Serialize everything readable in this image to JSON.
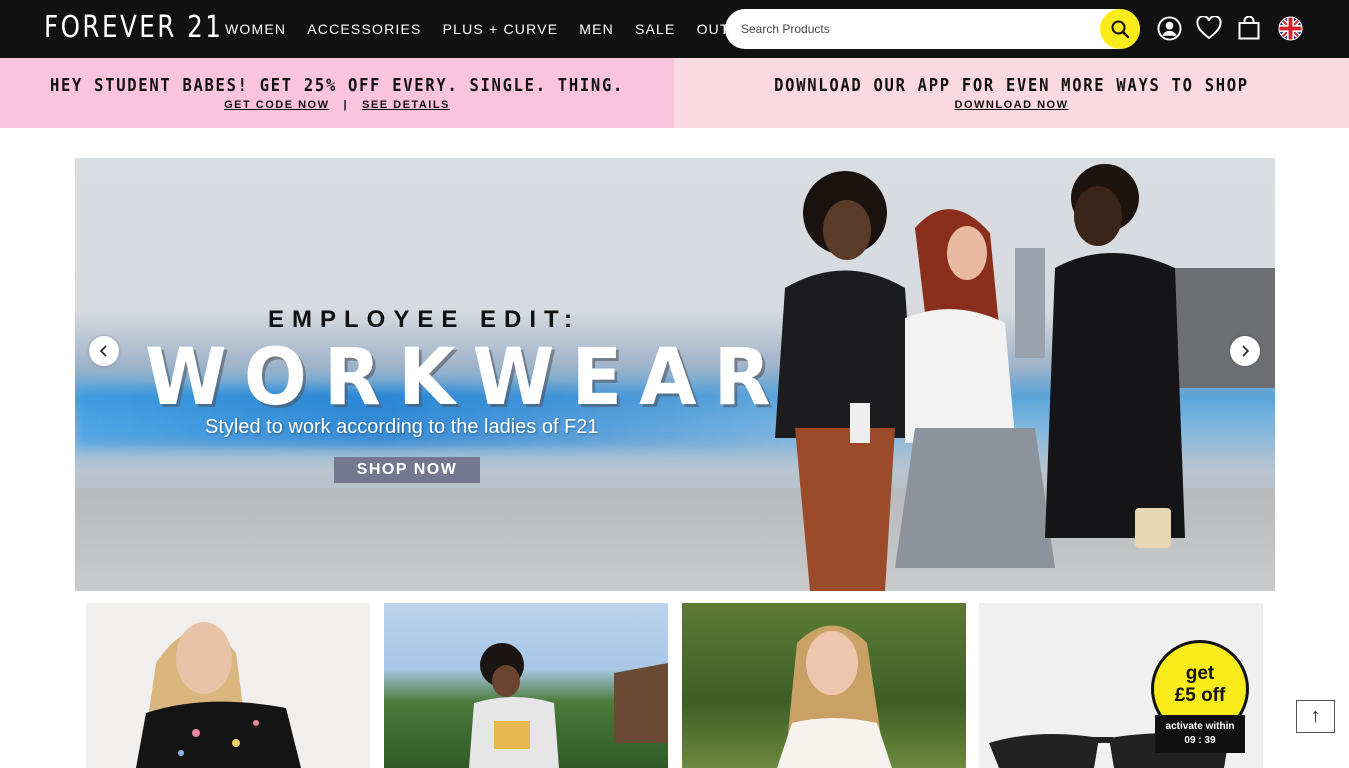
{
  "header": {
    "logo": "FOREVER 21",
    "nav": [
      "WOMEN",
      "ACCESSORIES",
      "PLUS + CURVE",
      "MEN",
      "SALE",
      "OUTLET"
    ],
    "search_placeholder": "Search Products",
    "icons": [
      "search-icon",
      "account-icon",
      "wishlist-heart-icon",
      "shopping-bag-icon",
      "uk-flag-icon"
    ]
  },
  "promos": [
    {
      "title": "HEY STUDENT BABES! GET 25% OFF EVERY. SINGLE. THING.",
      "links": [
        "GET CODE NOW",
        "SEE DETAILS"
      ],
      "separator": "|"
    },
    {
      "title": "DOWNLOAD OUR APP FOR EVEN MORE WAYS TO SHOP",
      "links": [
        "DOWNLOAD NOW"
      ]
    }
  ],
  "hero": {
    "eyebrow": "EMPLOYEE EDIT:",
    "headline": "WORKWEAR",
    "subhead": "Styled to work according to the ladies of F21",
    "cta": "SHOP NOW",
    "prev_icon": "chevron-left-icon",
    "next_icon": "chevron-right-icon",
    "colors": {
      "cta_bg": "#727890"
    }
  },
  "coupon": {
    "title_line1": "get",
    "title_line2": "£5 off",
    "timer_label": "activate within",
    "timer_value": "09 : 39"
  },
  "back_to_top": "↑",
  "colors": {
    "header_bg": "#111111",
    "accent_yellow": "#f9ec1a",
    "promo_pink": "#f9c4dc",
    "promo_light_pink": "#fbd9e3"
  }
}
